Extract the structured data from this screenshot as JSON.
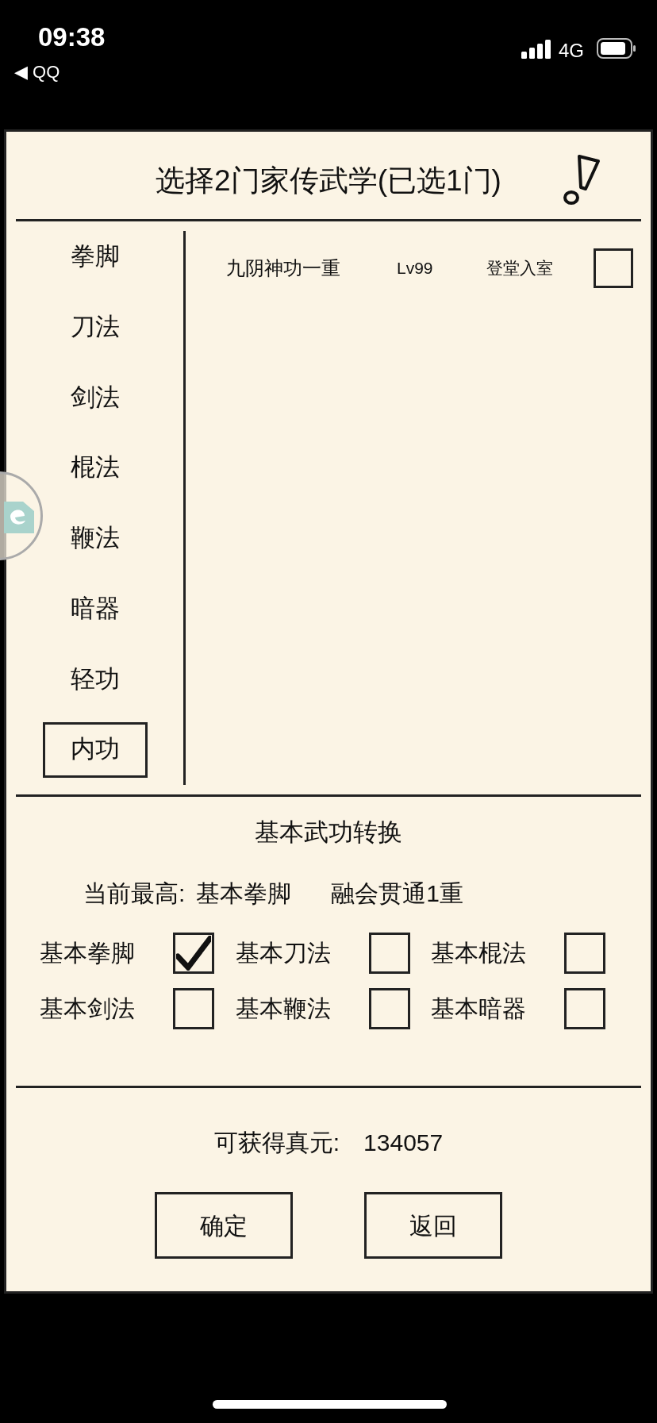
{
  "status_bar": {
    "time": "09:38",
    "back_label": "◀ QQ",
    "network": "4G"
  },
  "dialog": {
    "title": "选择2门家传武学(已选1门)",
    "categories": [
      {
        "label": "拳脚",
        "selected": false
      },
      {
        "label": "刀法",
        "selected": false
      },
      {
        "label": "剑法",
        "selected": false
      },
      {
        "label": "棍法",
        "selected": false
      },
      {
        "label": "鞭法",
        "selected": false
      },
      {
        "label": "暗器",
        "selected": false
      },
      {
        "label": "轻功",
        "selected": false
      },
      {
        "label": "内功",
        "selected": true
      }
    ],
    "skills": [
      {
        "name": "九阴神功一重",
        "level": "Lv99",
        "rank": "登堂入室",
        "checked": false
      }
    ],
    "conversion": {
      "heading": "基本武功转换",
      "current_label": "当前最高:",
      "current_skill": "基本拳脚",
      "current_rank": "融会贯通1重",
      "options": [
        {
          "label": "基本拳脚",
          "checked": true
        },
        {
          "label": "基本刀法",
          "checked": false
        },
        {
          "label": "基本棍法",
          "checked": false
        },
        {
          "label": "基本剑法",
          "checked": false
        },
        {
          "label": "基本鞭法",
          "checked": false
        },
        {
          "label": "基本暗器",
          "checked": false
        }
      ]
    },
    "reward": {
      "label": "可获得真元:",
      "value": "134057"
    },
    "buttons": [
      "确定",
      "返回"
    ]
  }
}
